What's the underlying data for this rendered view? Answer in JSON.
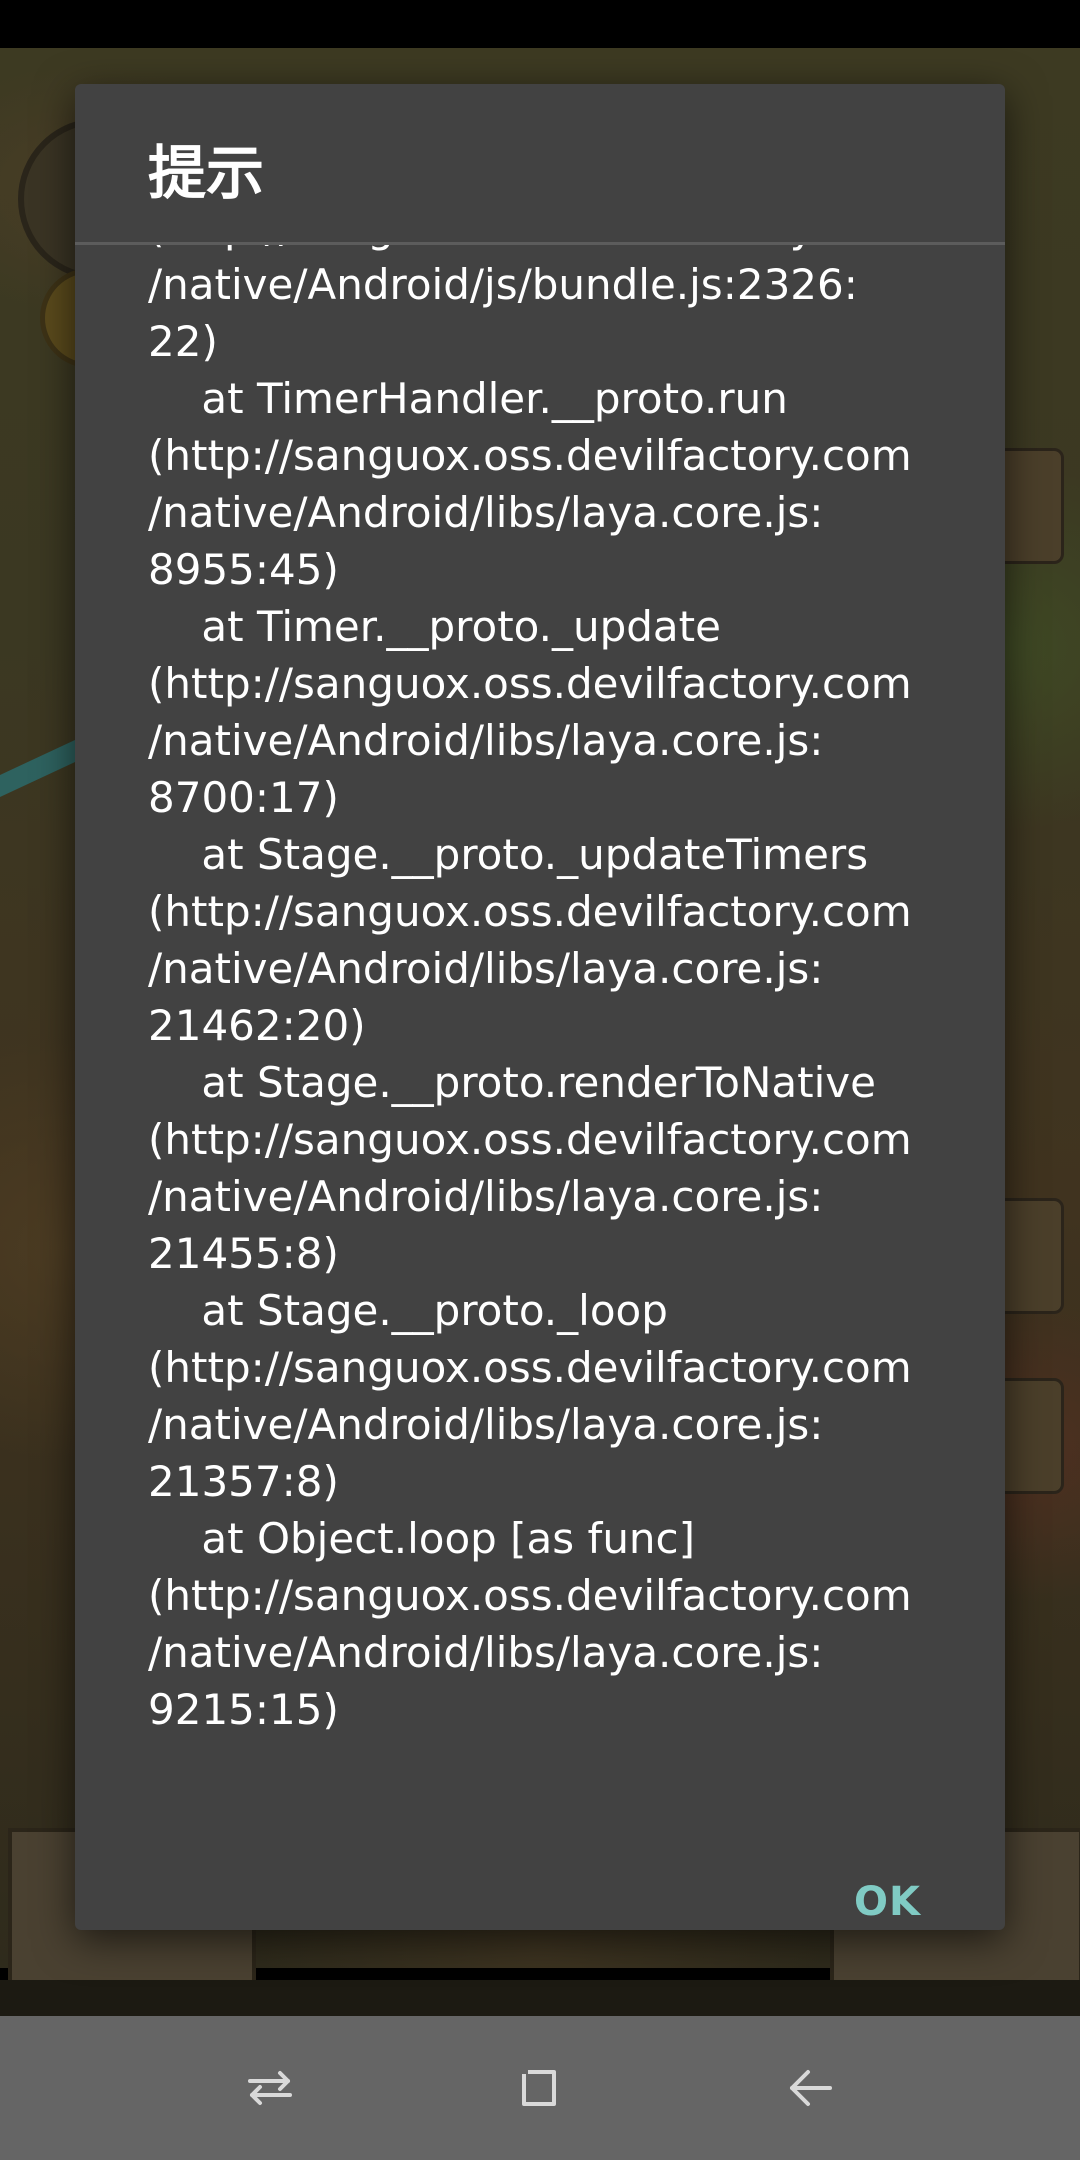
{
  "dialog": {
    "title": "提示",
    "message": "(http://sanguox.oss.devilfactory.com\n/native/Android/js/bundle.js:2326:\n22)\n    at TimerHandler.__proto.run\n(http://sanguox.oss.devilfactory.com\n/native/Android/libs/laya.core.js:\n8955:45)\n    at Timer.__proto._update\n(http://sanguox.oss.devilfactory.com\n/native/Android/libs/laya.core.js:\n8700:17)\n    at Stage.__proto._updateTimers\n(http://sanguox.oss.devilfactory.com\n/native/Android/libs/laya.core.js:\n21462:20)\n    at Stage.__proto.renderToNative\n(http://sanguox.oss.devilfactory.com\n/native/Android/libs/laya.core.js:\n21455:8)\n    at Stage.__proto._loop\n(http://sanguox.oss.devilfactory.com\n/native/Android/libs/laya.core.js:\n21357:8)\n    at Object.loop [as func]\n(http://sanguox.oss.devilfactory.com\n/native/Android/libs/laya.core.js:\n9215:15)",
    "ok_label": "OK"
  },
  "nav_bar": {
    "icons": [
      "recent-apps-icon",
      "home-icon",
      "back-icon"
    ]
  },
  "colors": {
    "dialog_bg": "#424242",
    "accent": "#80cbc4",
    "nav_bg": "#656565"
  }
}
